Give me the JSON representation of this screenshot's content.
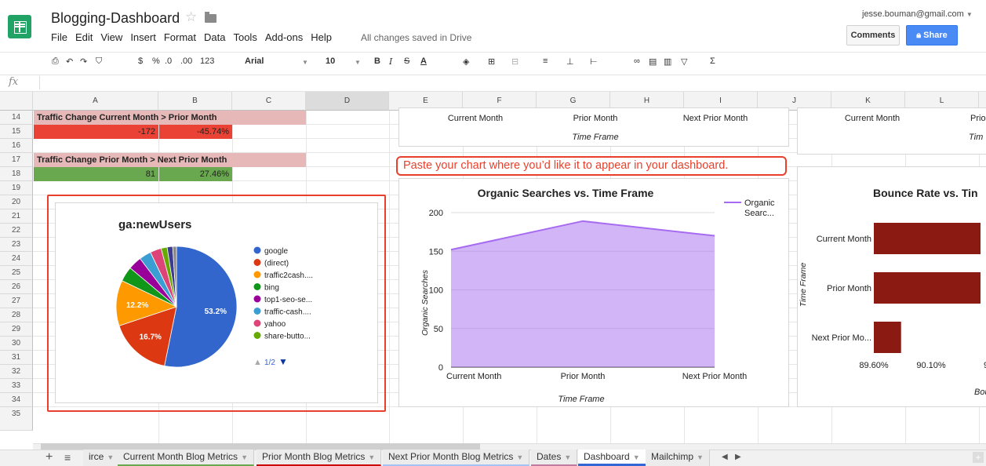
{
  "header": {
    "doc_title": "Blogging-Dashboard",
    "menus": [
      "File",
      "Edit",
      "View",
      "Insert",
      "Format",
      "Data",
      "Tools",
      "Add-ons",
      "Help"
    ],
    "save_status": "All changes saved in Drive",
    "user_email": "jesse.bouman@gmail.com",
    "comments_label": "Comments",
    "share_label": "Share"
  },
  "toolbar": {
    "currency": "$",
    "percent": "%",
    "dec_less": ".0",
    "dec_more": ".00",
    "more_formats": "123",
    "font": "Arial",
    "font_size": "10",
    "bold": "B",
    "italic": "I",
    "strike": "S",
    "text_color": "A",
    "sum": "Σ"
  },
  "formula_bar": {
    "fx": "fx"
  },
  "columns": [
    "A",
    "B",
    "C",
    "D",
    "E",
    "F",
    "G",
    "H",
    "I",
    "J",
    "K",
    "L"
  ],
  "rows": [
    "14",
    "15",
    "16",
    "17",
    "18",
    "19",
    "20",
    "21",
    "22",
    "23",
    "24",
    "25",
    "26",
    "27",
    "28",
    "29",
    "30",
    "31",
    "32",
    "33",
    "34",
    "35"
  ],
  "cells": {
    "a14": "Traffic Change Current Month > Prior Month",
    "a15": "-172",
    "b15": "-45.74%",
    "a17": "Traffic Change Prior Month > Next Prior Month",
    "a18": "81",
    "b18": "27.46%"
  },
  "callout": "Paste your chart where you’d like it to appear in your dashboard.",
  "charts": {
    "top_strip_left": {
      "categories": [
        "Current Month",
        "Prior Month",
        "Next Prior Month"
      ],
      "xlabel": "Time Frame"
    },
    "top_strip_right": {
      "categories": [
        "Current Month",
        "Prior"
      ],
      "xlabel": "Tim"
    }
  },
  "chart_data": [
    {
      "type": "pie",
      "title": "ga:newUsers",
      "labels": [
        "google",
        "(direct)",
        "traffic2cash....",
        "bing",
        "top1-seo-se...",
        "traffic-cash....",
        "yahoo",
        "share-butto..."
      ],
      "values": [
        53.2,
        16.7,
        12.2,
        4.0,
        3.6,
        3.2,
        3.0,
        1.6,
        1.5,
        1.0
      ],
      "colors": [
        "#3366cc",
        "#dc3912",
        "#ff9900",
        "#109618",
        "#990099",
        "#3b9ed3",
        "#dd4477",
        "#66aa00",
        "#3c3c90",
        "#888888"
      ],
      "slice_labels": [
        "53.2%",
        "16.7%",
        "12.2%"
      ],
      "legend_page": "1/2"
    },
    {
      "type": "area",
      "title": "Organic Searches vs. Time Frame",
      "categories": [
        "Current Month",
        "Prior Month",
        "Next Prior Month"
      ],
      "series": [
        {
          "name": "Organic Searc...",
          "values": [
            152,
            189,
            170
          ]
        }
      ],
      "xlabel": "Time Frame",
      "ylabel": "Organic Searches",
      "ylim": [
        0,
        200
      ],
      "yticks": [
        "0",
        "50",
        "100",
        "150",
        "200"
      ],
      "color": "#a66bf0"
    },
    {
      "type": "bar",
      "title": "Bounce Rate vs. Tin",
      "categories": [
        "Current Month",
        "Prior Month",
        "Next Prior Mo..."
      ],
      "values": [
        90.54,
        90.54,
        89.84
      ],
      "xlim": [
        89.6,
        90.54
      ],
      "xticks": [
        "89.60%",
        "90.10%",
        "9"
      ],
      "ylabel": "Time Frame",
      "xlabel": "Bou",
      "color": "#8b1a12"
    }
  ],
  "sheet_tabs": [
    {
      "label": "irce",
      "color": "#999999"
    },
    {
      "label": "Current Month Blog Metrics",
      "color": "#6aa84f"
    },
    {
      "label": "Prior Month Blog Metrics",
      "color": "#cc0000"
    },
    {
      "label": "Next Prior Month Blog Metrics",
      "color": "#a4c2f4"
    },
    {
      "label": "Dates",
      "color": "#c27ba0"
    },
    {
      "label": "Dashboard",
      "color": "#3367d6"
    },
    {
      "label": "Mailchimp",
      "color": "#cccccc"
    }
  ],
  "sheet_controls": {
    "add": "+",
    "list": "≡"
  }
}
